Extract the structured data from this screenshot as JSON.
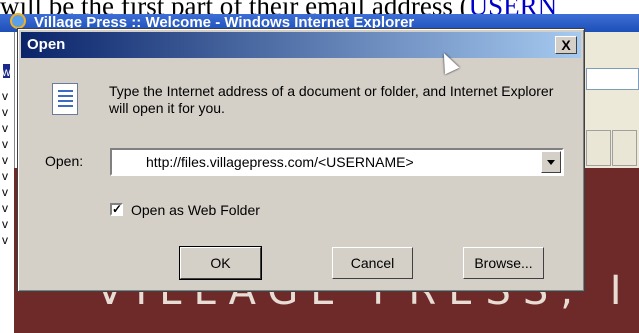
{
  "page": {
    "top_text_before": "will be the first part of their email address (",
    "top_link": "USERN"
  },
  "ie_window": {
    "title": "Village Press :: Welcome - Windows Internet Explorer",
    "left_letters": [
      "w",
      "v",
      "v",
      "v",
      "v",
      "v",
      "v",
      "v",
      "v",
      "v",
      "v"
    ],
    "banner_text": "VILLAGE PRESS, INC",
    "banner_color": "#6e2a28"
  },
  "dialog": {
    "title": "Open",
    "close_label": "X",
    "description": "Type the Internet address of a document or folder, and Internet Explorer will open it for you.",
    "open_label": "Open:",
    "open_value": "http://files.villagepress.com/<USERNAME>",
    "checkbox_label": "Open as Web Folder",
    "checkbox_checked": true,
    "checkbox_mark": "✓",
    "ok_label": "OK",
    "cancel_label": "Cancel",
    "browse_label": "Browse...",
    "icon": "document-icon"
  },
  "colors": {
    "titlebar_start": "#0a246a",
    "titlebar_end": "#a6caf0",
    "dialog_bg": "#d4d0c8"
  }
}
